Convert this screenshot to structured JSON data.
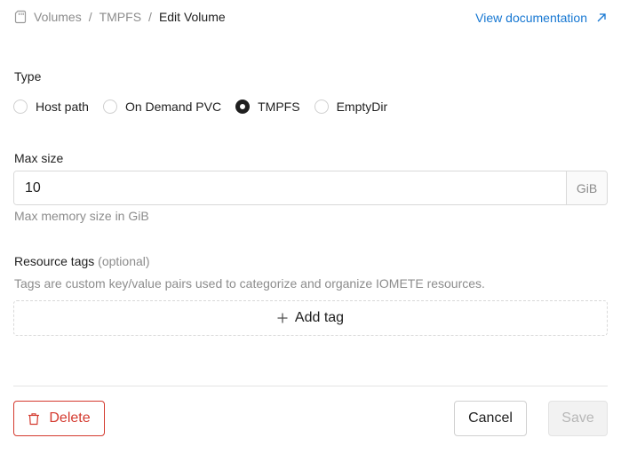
{
  "breadcrumb": {
    "items": [
      "Volumes",
      "TMPFS"
    ],
    "separator": "/",
    "current": "Edit Volume",
    "icon": "sd-card-icon"
  },
  "doc_link": {
    "label": "View documentation",
    "icon": "arrow-up-right-icon"
  },
  "type_section": {
    "label": "Type",
    "options": [
      "Host path",
      "On Demand PVC",
      "TMPFS",
      "EmptyDir"
    ],
    "selected": "TMPFS"
  },
  "max_size": {
    "label": "Max size",
    "value": "10",
    "unit": "GiB",
    "help": "Max memory size in GiB"
  },
  "resource_tags": {
    "label": "Resource tags",
    "optional": "(optional)",
    "help": "Tags are custom key/value pairs used to categorize and organize IOMETE resources.",
    "add_label": "Add tag"
  },
  "footer": {
    "delete_label": "Delete",
    "cancel_label": "Cancel",
    "save_label": "Save"
  },
  "colors": {
    "link": "#1677d2",
    "danger": "#d43a2f",
    "text": "#1f1f1f",
    "muted": "#8c8c8c"
  }
}
